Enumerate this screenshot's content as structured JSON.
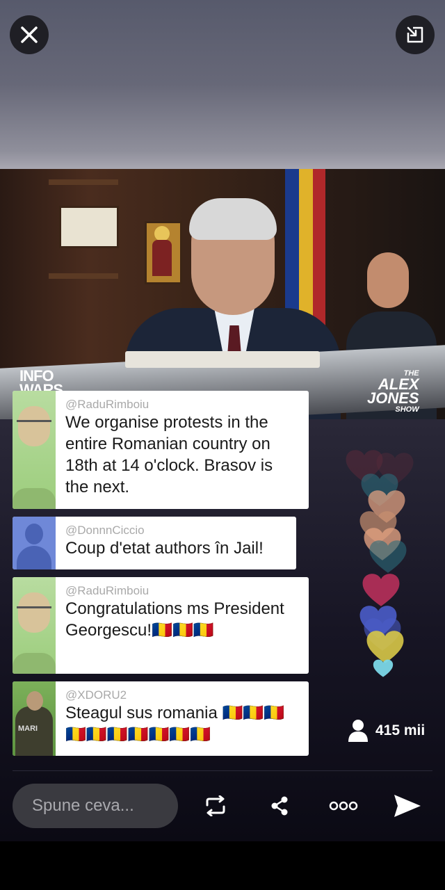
{
  "top_bar": {
    "close_icon": "close-icon",
    "minimize_icon": "minimize-window-icon"
  },
  "video": {
    "logo_left": "INFO WARS",
    "logo_right_top": "THE",
    "logo_right_main1": "ALEX",
    "logo_right_main2": "JONES",
    "logo_right_bottom": "SHOW"
  },
  "comments": [
    {
      "username": "@RaduRimboiu",
      "text": "We organise protests in the entire Romanian country on 18th at 14 o'clock. Brasov is the next."
    },
    {
      "username": "@DonnnCiccio",
      "text": "Coup d'etat authors în Jail!"
    },
    {
      "username": "@RaduRimboiu",
      "text": "Congratulations ms President Georgescu!🇷🇴🇷🇴🇷🇴"
    },
    {
      "username": "@XDORU2",
      "text": "Steagul sus romania 🇷🇴🇷🇴🇷🇴🇷🇴🇷🇴🇷🇴🇷🇴🇷🇴🇷🇴🇷🇴"
    }
  ],
  "viewers": {
    "count": "415 mii",
    "icon": "person-icon"
  },
  "bottom_bar": {
    "input_placeholder": "Spune ceva...",
    "icons": [
      "repost-icon",
      "share-icon",
      "more-icon",
      "send-icon"
    ]
  },
  "colors": {
    "heart_colors": [
      "#5a2a3a",
      "#2b6b7a",
      "#e0a080",
      "#c89070",
      "#b8305a",
      "#4a5cc8",
      "#d8c848",
      "#7cd8e8"
    ]
  }
}
